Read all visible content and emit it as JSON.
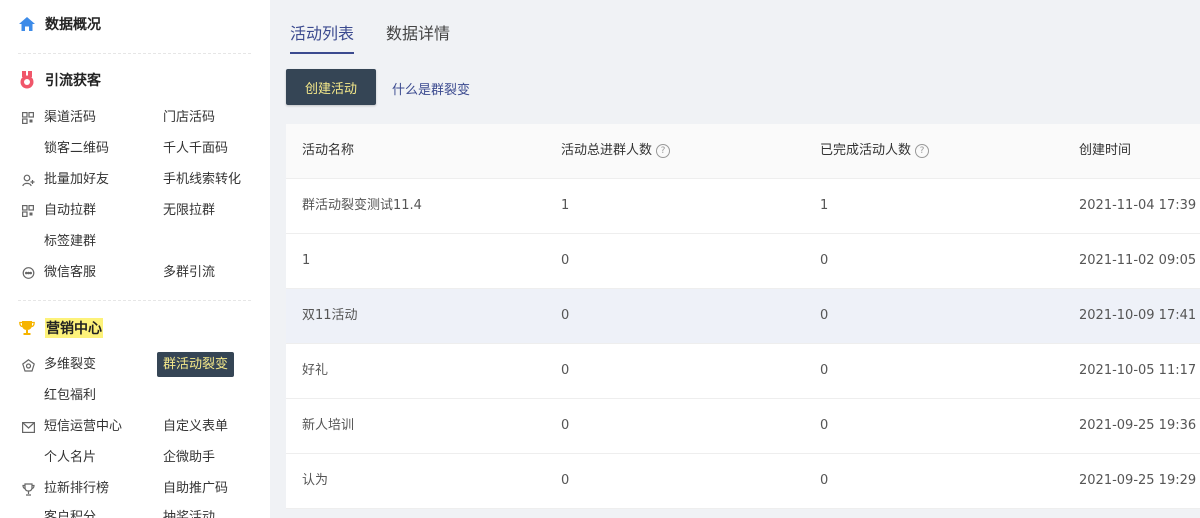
{
  "sidebar": {
    "overview": {
      "title": "数据概况",
      "icon": "home-icon"
    },
    "traffic": {
      "title": "引流获客",
      "icon": "medal-icon",
      "items": [
        {
          "label": "渠道活码",
          "icon": "qrcode-icon"
        },
        {
          "label": "门店活码"
        },
        {
          "label": "锁客二维码"
        },
        {
          "label": "千人千面码"
        },
        {
          "label": "批量加好友",
          "icon": "add-friend-icon"
        },
        {
          "label": "手机线索转化"
        },
        {
          "label": "自动拉群",
          "icon": "qrcode-icon"
        },
        {
          "label": "无限拉群"
        },
        {
          "label": "标签建群"
        },
        {
          "label": "微信客服",
          "icon": "chat-icon"
        },
        {
          "label": "多群引流"
        }
      ]
    },
    "marketing": {
      "title": "营销中心",
      "icon": "trophy-icon",
      "items": [
        {
          "label": "多维裂变",
          "icon": "pentagon-icon"
        },
        {
          "label": "群活动裂变",
          "active": true
        },
        {
          "label": "红包福利"
        },
        {
          "label": "短信运营中心",
          "icon": "mail-icon"
        },
        {
          "label": "自定义表单"
        },
        {
          "label": "个人名片"
        },
        {
          "label": "企微助手"
        },
        {
          "label": "拉新排行榜",
          "icon": "cup-icon"
        },
        {
          "label": "自助推广码"
        },
        {
          "label": "客户积分"
        },
        {
          "label": "抽奖活动"
        }
      ]
    }
  },
  "main": {
    "tabs": [
      {
        "label": "活动列表",
        "active": true
      },
      {
        "label": "数据详情"
      }
    ],
    "create_button": "创建活动",
    "help_link": "什么是群裂变",
    "table": {
      "headers": [
        "活动名称",
        "活动总进群人数",
        "已完成活动人数",
        "创建时间"
      ],
      "help_icon_text": "?",
      "rows": [
        [
          "群活动裂变测试11.4",
          "1",
          "1",
          "2021-11-04 17:39"
        ],
        [
          "1",
          "0",
          "0",
          "2021-11-02 09:05"
        ],
        [
          "双11活动",
          "0",
          "0",
          "2021-10-09 17:41"
        ],
        [
          "好礼",
          "0",
          "0",
          "2021-10-05 11:17"
        ],
        [
          "新人培训",
          "0",
          "0",
          "2021-09-25 19:36"
        ],
        [
          "认为",
          "0",
          "0",
          "2021-09-25 19:29"
        ]
      ]
    }
  },
  "colors": {
    "accent": "#3b4a8f",
    "dark_button": "#354555",
    "button_text": "#f5e98a",
    "highlight": "#fdf27a",
    "home_icon": "#3d8be8",
    "medal_icon": "#f0566a",
    "trophy_icon": "#f6b400"
  }
}
